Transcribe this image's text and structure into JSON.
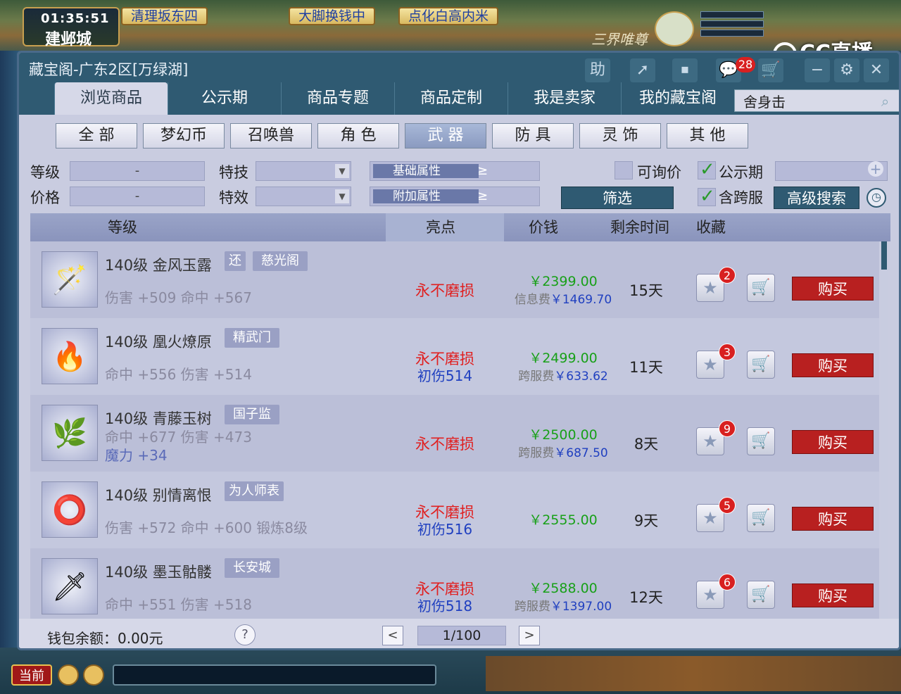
{
  "game": {
    "clock": "01:35:51",
    "city": "建邺城",
    "quests": [
      "清理坂东四",
      "大脚换钱中",
      "点化白高内米"
    ],
    "overlay_text": "三界唯尊",
    "stream_logo": "CC直播"
  },
  "window": {
    "title": "藏宝阁-广东2区[万绿湖]",
    "help_label": "助",
    "message_count": "28"
  },
  "tabs": [
    "浏览商品",
    "公示期",
    "商品专题",
    "商品定制",
    "我是卖家",
    "我的藏宝阁"
  ],
  "search": {
    "value": "舍身击"
  },
  "categories": [
    "全 部",
    "梦幻币",
    "召唤兽",
    "角 色",
    "武 器",
    "防 具",
    "灵 饰",
    "其 他"
  ],
  "filters": {
    "level_label": "等级",
    "price_label": "价格",
    "range_sep": "-",
    "skill_label": "特技",
    "effect_label": "特效",
    "base_attr": "基础属性",
    "extra_attr": "附加属性",
    "attr_arrow": "≥",
    "negotiable_label": "可询价",
    "public_label": "公示期",
    "cross_label": "含跨服",
    "filter_btn": "筛选",
    "adv_search_btn": "高级搜索"
  },
  "table": {
    "headers": {
      "level": "等级",
      "highlight": "亮点",
      "price": "价钱",
      "remain": "剩余时间",
      "fav": "收藏"
    },
    "buy_label": "购买",
    "rows": [
      {
        "icon": "🪄",
        "name": "140级 金风玉露",
        "tag1": "还",
        "tag2": "慈光阁",
        "attrs": [
          "伤害 +509 命中 +567"
        ],
        "attr3": "",
        "hl1": "永不磨损",
        "hl2": "",
        "price": "￥2399.00",
        "fee_label": "信息费",
        "fee": "￥1469.70",
        "remain": "15天",
        "fav": "2"
      },
      {
        "icon": "🔥",
        "name": "140级 凰火燎原",
        "tag1": "精武门",
        "tag2": "",
        "attrs": [
          "命中 +556 伤害 +514"
        ],
        "attr3": "",
        "hl1": "永不磨损",
        "hl2": "初伤514",
        "price": "￥2499.00",
        "fee_label": "跨服费",
        "fee": "￥633.62",
        "remain": "11天",
        "fav": "3"
      },
      {
        "icon": "🌿",
        "name": "140级 青藤玉树",
        "tag1": "国子监",
        "tag2": "",
        "attrs": [
          "命中 +677 伤害 +473"
        ],
        "attr3": "魔力 +34",
        "hl1": "永不磨损",
        "hl2": "",
        "price": "￥2500.00",
        "fee_label": "跨服费",
        "fee": "￥687.50",
        "remain": "8天",
        "fav": "9"
      },
      {
        "icon": "⭕",
        "name": "140级 别情离恨",
        "tag1": "为人师表",
        "tag2": "",
        "attrs": [
          "伤害 +572 命中 +600 锻炼8级"
        ],
        "attr3": "",
        "hl1": "永不磨损",
        "hl2": "初伤516",
        "price": "￥2555.00",
        "fee_label": "",
        "fee": "",
        "remain": "9天",
        "fav": "5"
      },
      {
        "icon": "🗡",
        "name": "140级 墨玉骷髅",
        "tag1": "长安城",
        "tag2": "",
        "attrs": [
          "命中 +551 伤害 +518"
        ],
        "attr3": "",
        "hl1": "永不磨损",
        "hl2": "初伤518",
        "price": "￥2588.00",
        "fee_label": "跨服费",
        "fee": "￥1397.00",
        "remain": "12天",
        "fav": "6"
      }
    ]
  },
  "footer": {
    "wallet": "钱包余额：0.00元",
    "help": "?",
    "page": "1/100",
    "prev": "<",
    "next": ">"
  },
  "bottom": {
    "current_tag": "当前"
  }
}
